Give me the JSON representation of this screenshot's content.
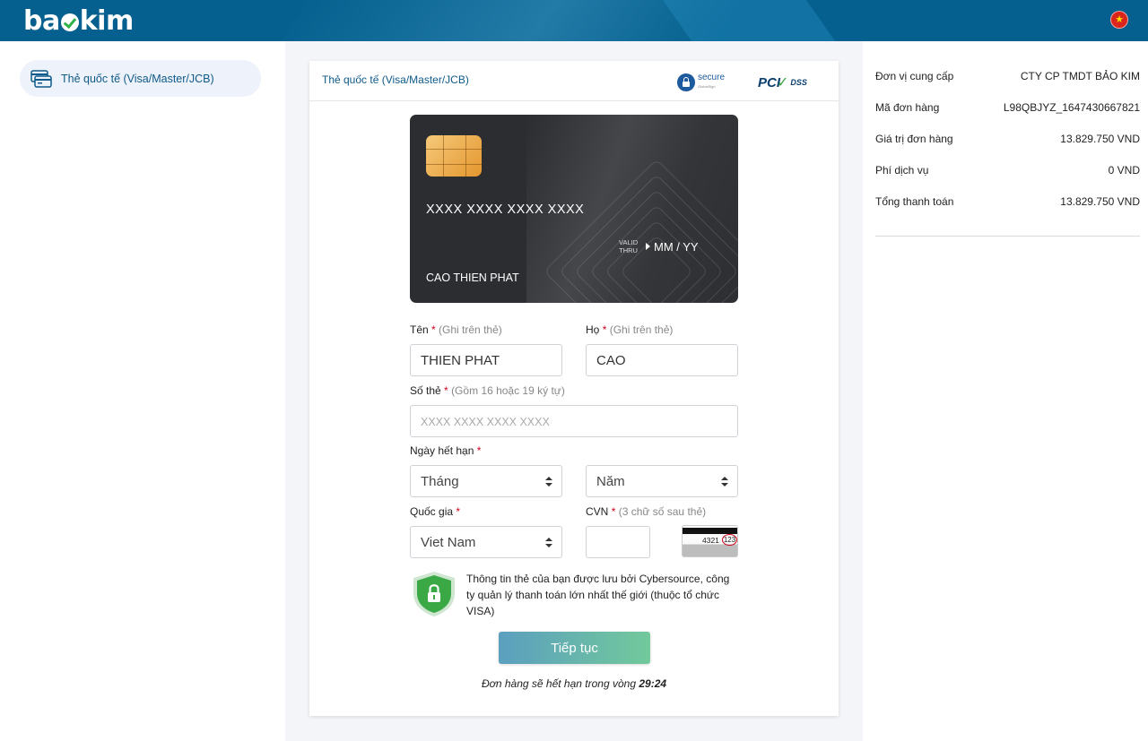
{
  "header": {
    "logo_text_left": "ba",
    "logo_text_right": "kim",
    "language_flag": "vn-flag-icon"
  },
  "sidebar": {
    "items": [
      {
        "label": "Thẻ quốc tế (Visa/Master/JCB)",
        "icon": "credit-card-icon",
        "active": true
      }
    ]
  },
  "panel": {
    "title": "Thẻ quốc tế (Visa/Master/JCB)",
    "secure_badge_text": "secure",
    "secure_badge_sub": "GlobalSign",
    "pci_text": "PCI",
    "dss_text": "DSS"
  },
  "card_preview": {
    "number": "XXXX XXXX XXXX XXXX",
    "valid_label_1": "VALID",
    "valid_label_2": "THRU",
    "expiry": "MM / YY",
    "holder": "CAO THIEN PHAT"
  },
  "form": {
    "first_name": {
      "label": "Tên",
      "required": "*",
      "hint": "(Ghi trên thẻ)",
      "value": "THIEN PHAT"
    },
    "last_name": {
      "label": "Họ",
      "required": "*",
      "hint": "(Ghi trên thẻ)",
      "value": "CAO"
    },
    "card_number": {
      "label": "Số thẻ",
      "required": "*",
      "hint": "(Gồm 16 hoặc 19 ký tự)",
      "value": "",
      "placeholder": "XXXX XXXX XXXX XXXX"
    },
    "expiry": {
      "label": "Ngày hết hạn",
      "required": "*",
      "month": "Tháng",
      "year": "Năm"
    },
    "country": {
      "label": "Quốc gia",
      "required": "*",
      "value": "Viet Nam"
    },
    "cvn": {
      "label": "CVN",
      "required": "*",
      "hint": "(3 chữ số sau thẻ)",
      "value": "",
      "sample_digits": "4321",
      "sample_code": "123"
    },
    "security_note": "Thông tin thẻ của bạn được lưu bởi Cybersource, công ty quản lý thanh toán lớn nhất thế giới (thuộc tổ chức VISA)",
    "continue_label": "Tiếp tục",
    "expire_prefix": "Đơn hàng sẽ hết hạn trong vòng",
    "expire_time": "29:24"
  },
  "summary": {
    "rows": [
      {
        "key": "Đơn vị cung cấp",
        "value": "CTY CP TMDT BẢO KIM"
      },
      {
        "key": "Mã đơn hàng",
        "value": "L98QBJYZ_1647430667821"
      },
      {
        "key": "Giá trị đơn hàng",
        "value": "13.829.750 VND"
      },
      {
        "key": "Phí dịch vụ",
        "value": "0 VND"
      },
      {
        "key": "Tổng thanh toán",
        "value": "13.829.750 VND"
      }
    ]
  },
  "colors": {
    "header_bg": "#05608f",
    "accent_text": "#0e5a8a",
    "required": "#d0021b",
    "button_gradient_start": "#5b9fbf",
    "button_gradient_end": "#72c99b",
    "shield_green": "#3aa845"
  }
}
